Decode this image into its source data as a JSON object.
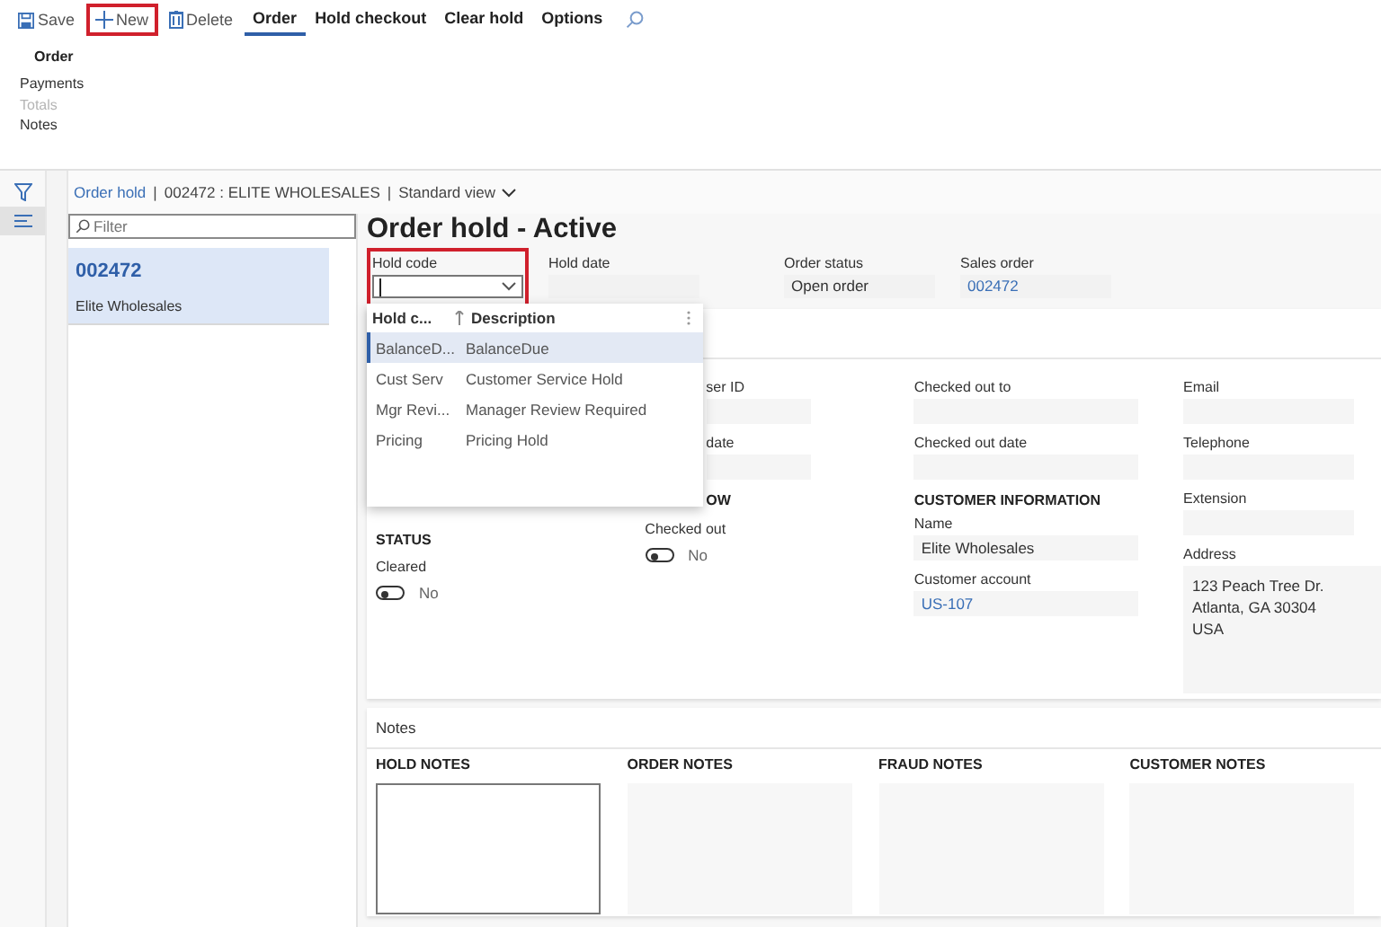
{
  "toolbar": {
    "actions": [
      {
        "kind": "save",
        "label": "Save",
        "highlighted": false
      },
      {
        "kind": "new",
        "label": "New",
        "highlighted": true
      },
      {
        "kind": "delete",
        "label": "Delete",
        "highlighted": false
      }
    ],
    "tabs": [
      {
        "label": "Order",
        "selected": true
      },
      {
        "label": "Hold checkout",
        "selected": false
      },
      {
        "label": "Clear hold",
        "selected": false
      },
      {
        "label": "Options",
        "selected": false
      }
    ]
  },
  "ribbon": {
    "group": "Order",
    "items": [
      {
        "label": "Payments",
        "disabled": false
      },
      {
        "label": "Totals",
        "disabled": true
      },
      {
        "label": "Notes",
        "disabled": false
      }
    ]
  },
  "nav": [
    {
      "kind": "filter",
      "selected": false
    },
    {
      "kind": "list",
      "selected": true
    }
  ],
  "breadcrumb": {
    "page": "Order hold",
    "separators": [
      "|",
      "|"
    ],
    "record": "002472 : ELITE WHOLESALES",
    "view": "Standard view"
  },
  "list": {
    "filter_placeholder": "Filter",
    "items": [
      {
        "id": "002472",
        "name": "Elite Wholesales",
        "selected": true
      }
    ]
  },
  "title": "Order hold - Active",
  "header_fields": [
    {
      "kind": "combo",
      "label": "Hold code",
      "highlighted": true
    },
    {
      "kind": "text",
      "label": "Hold date",
      "highlighted": false
    },
    {
      "kind": "text",
      "label": "Order status",
      "value": "Open order",
      "highlighted": false
    },
    {
      "kind": "link",
      "label": "Sales order",
      "value": "002472",
      "highlighted": false
    }
  ],
  "dropdown": {
    "columns": [
      "Hold c...",
      "Description"
    ],
    "rows": [
      {
        "code": "BalanceD...",
        "description": "BalanceDue",
        "selected": true
      },
      {
        "code": "Cust Serv",
        "description": "Customer Service Hold",
        "selected": false
      },
      {
        "code": "Mgr Revi...",
        "description": "Manager Review Required",
        "selected": false
      },
      {
        "code": "Pricing",
        "description": "Pricing Hold",
        "selected": false
      }
    ]
  },
  "details": {
    "columns": [
      {
        "items": [
          {
            "kind": "heading",
            "text": "STATUS"
          },
          {
            "kind": "toggle",
            "label": "Cleared",
            "on": false,
            "text": "No"
          }
        ]
      },
      {
        "items": [
          {
            "kind": "field",
            "label": "ser ID",
            "clipped": true
          },
          {
            "kind": "field",
            "label": "date",
            "clipped": true
          },
          {
            "kind": "heading",
            "text": "OW",
            "clipped": true
          },
          {
            "kind": "toggle",
            "label": "Checked out",
            "on": false,
            "text": "No"
          }
        ]
      },
      {
        "items": [
          {
            "kind": "field",
            "label": "Checked out to"
          },
          {
            "kind": "field",
            "label": "Checked out date"
          },
          {
            "kind": "heading",
            "text": "CUSTOMER INFORMATION"
          },
          {
            "kind": "field",
            "label": "Name",
            "value": "Elite Wholesales"
          },
          {
            "kind": "link",
            "label": "Customer account",
            "value": "US-107"
          }
        ]
      },
      {
        "items": [
          {
            "kind": "field",
            "label": "Email"
          },
          {
            "kind": "field",
            "label": "Telephone"
          },
          {
            "kind": "field",
            "label": "Extension"
          },
          {
            "kind": "address",
            "label": "Address",
            "lines": [
              "123 Peach Tree Dr.",
              "Atlanta, GA 30304",
              "USA"
            ]
          }
        ]
      }
    ]
  },
  "notes": {
    "title": "Notes",
    "sections": [
      {
        "heading": "HOLD NOTES",
        "editable": true
      },
      {
        "heading": "ORDER NOTES",
        "editable": false
      },
      {
        "heading": "FRAUD NOTES",
        "editable": false
      },
      {
        "heading": "CUSTOMER NOTES",
        "editable": false
      }
    ]
  }
}
